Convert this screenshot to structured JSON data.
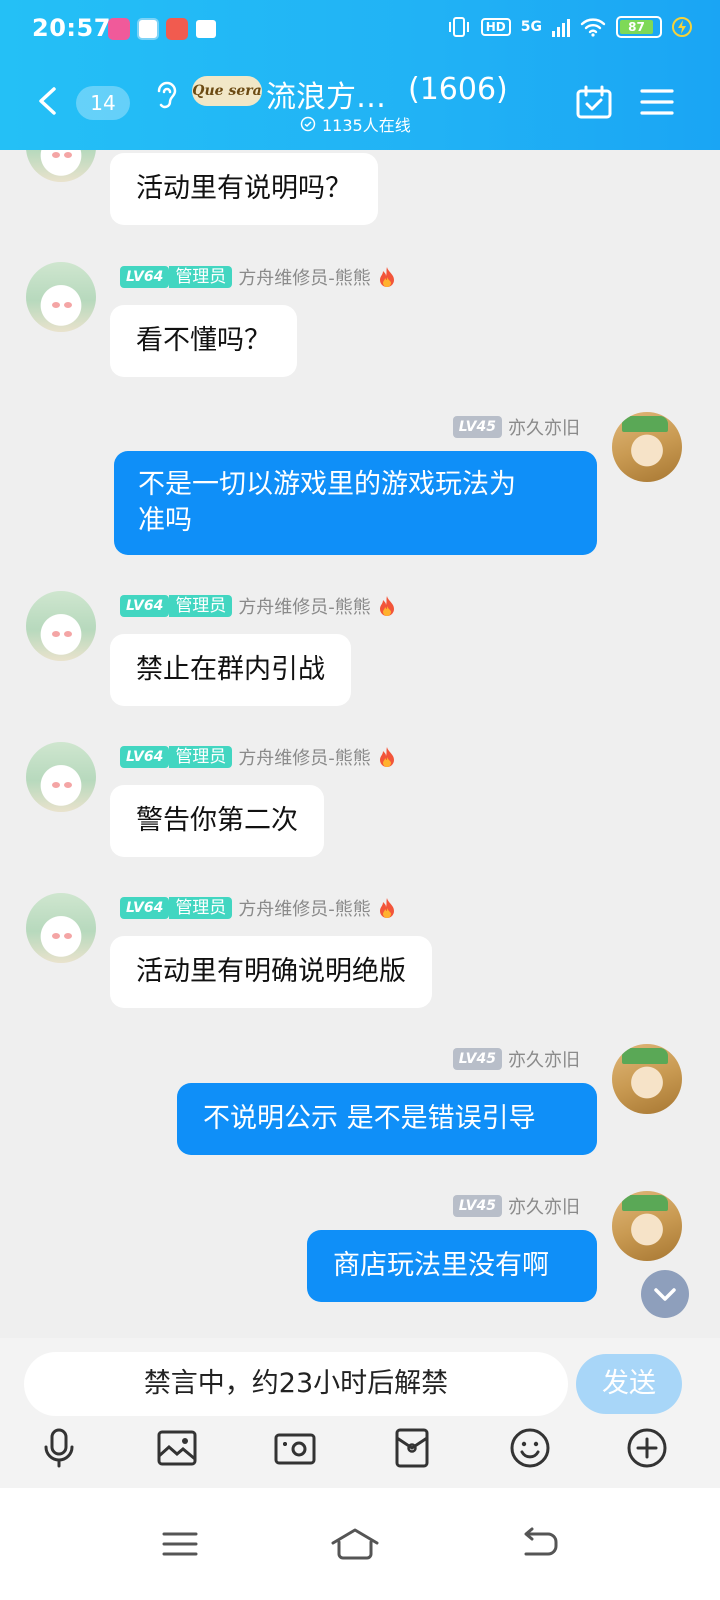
{
  "status_bar": {
    "time": "20:57",
    "hd": "HD",
    "network": "5G",
    "battery": "87"
  },
  "header": {
    "unread_count": "14",
    "logo_text": "Que sera",
    "group_name": "流浪方…",
    "member_count": "(1606)",
    "online_text": "1135人在线"
  },
  "messages": [
    {
      "side": "in",
      "text": "活动里有说明吗？"
    },
    {
      "side": "in",
      "level": "LV64",
      "role": "管理员",
      "sender": "方舟维修员-熊熊",
      "text": "看不懂吗？"
    },
    {
      "side": "out",
      "level": "LV45",
      "sender": "亦久亦旧",
      "text_line1": "不是一切以游戏里的游戏玩法为",
      "text_line2": "准吗"
    },
    {
      "side": "in",
      "level": "LV64",
      "role": "管理员",
      "sender": "方舟维修员-熊熊",
      "text": "禁止在群内引战"
    },
    {
      "side": "in",
      "level": "LV64",
      "role": "管理员",
      "sender": "方舟维修员-熊熊",
      "text": "警告你第二次"
    },
    {
      "side": "in",
      "level": "LV64",
      "role": "管理员",
      "sender": "方舟维修员-熊熊",
      "text": "活动里有明确说明绝版"
    },
    {
      "side": "out",
      "level": "LV45",
      "sender": "亦久亦旧",
      "text": "不说明公示 是不是错误引导"
    },
    {
      "side": "out",
      "level": "LV45",
      "sender": "亦久亦旧",
      "text": "商店玩法里没有啊"
    }
  ],
  "input": {
    "muted_text": "禁言中，约23小时后解禁",
    "send_label": "发送"
  },
  "icons": {
    "back": "chevron-left-icon",
    "ear": "ear-icon",
    "calendar": "calendar-check-icon",
    "menu": "menu-icon",
    "voice": "microphone-icon",
    "image": "image-icon",
    "camera": "camera-icon",
    "red_packet": "red-packet-icon",
    "emoji": "emoji-icon",
    "plus": "plus-icon"
  },
  "colors": {
    "header": "#21b2f5",
    "out_bubble": "#0f8ff8",
    "admin_badge": "#42d6c1",
    "user_badge": "#b8bec9",
    "send_disabled": "#a8d6f8"
  }
}
